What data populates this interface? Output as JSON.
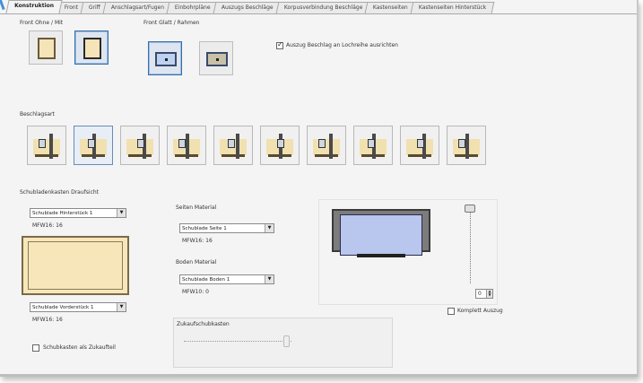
{
  "tabs": [
    {
      "label": "Konstruktion",
      "active": true
    },
    {
      "label": "Front",
      "active": false
    },
    {
      "label": "Griff",
      "active": false
    },
    {
      "label": "Anschlagsart/Fugen",
      "active": false
    },
    {
      "label": "Einbohrpläne",
      "active": false
    },
    {
      "label": "Auszugs Beschläge",
      "active": false
    },
    {
      "label": "Korpusverbindung Beschläge",
      "active": false
    },
    {
      "label": "Kastenseiten",
      "active": false
    },
    {
      "label": "Kastenseiten Hinterstück",
      "active": false
    }
  ],
  "front_group": {
    "label": "Front Ohne / Mit"
  },
  "front_flat_group": {
    "label": "Front Glatt / Rahmen"
  },
  "align_checkbox": {
    "label": "Auszug Beschlag an Lochreihe ausrichten",
    "checked": true
  },
  "fittings_group": {
    "label": "Beschlagsart",
    "count": 10,
    "selected_index": 1
  },
  "drawer_section": {
    "label": "Schubladenkasten Draufsicht"
  },
  "back_combo": {
    "value": "Schublade Hinterstück 1"
  },
  "back_thickness": {
    "text": "MFW16: 16"
  },
  "front_combo": {
    "value": "Schublade Vorderstück 1"
  },
  "front_thickness": {
    "text": "MFW16: 16"
  },
  "handle_checkbox": {
    "label": "Schubkasten als Zukaufteil",
    "checked": false
  },
  "side_material": {
    "label": "Seiten Material",
    "combo": "Schublade Seite 1",
    "thickness": "MFW16: 16"
  },
  "bottom_material": {
    "label": "Boden Material",
    "combo": "Schublade Boden 1",
    "thickness": "MFW10: 0"
  },
  "purchase_section": {
    "label": "Zukaufschubkasten"
  },
  "spin_value": "0",
  "full_extension": {
    "label": "Komplett Auszug",
    "checked": false
  },
  "icons": {
    "dropdown": "▼",
    "spin_up": "▲",
    "spin_down": "▼"
  }
}
